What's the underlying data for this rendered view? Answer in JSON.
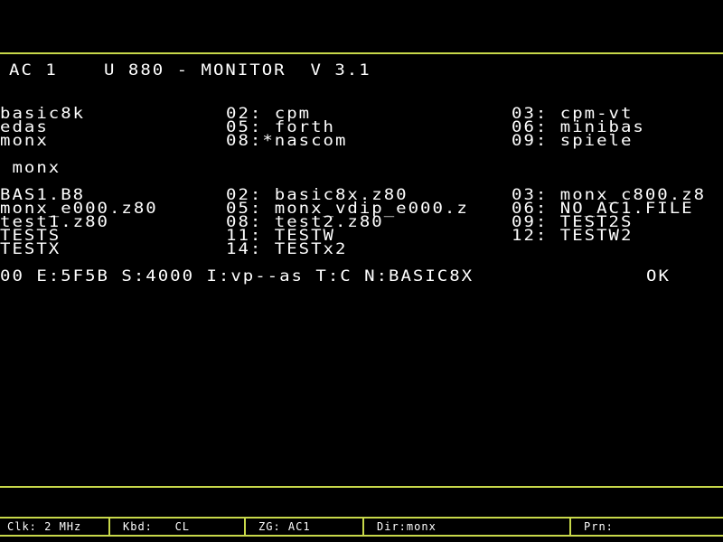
{
  "accent_color": "#c8d84a",
  "header": {
    "left": "AC 1",
    "center": "U 880 - MONITOR  V 3.1"
  },
  "lines": {
    "l1": {
      "c1": "basic8k",
      "c2": "02: cpm",
      "c3": "03: cpm-vt"
    },
    "l2": {
      "c1": "edas",
      "c2": "05: forth",
      "c3": "06: minibas"
    },
    "l3": {
      "c1": "monx",
      "c2": "08:*nascom",
      "c3": "09: spiele"
    },
    "l4": {
      "c1": " monx"
    },
    "l5": {
      "c1": "BAS1.B8",
      "c2": "02: basic8x.z80",
      "c3": "03: monx_c800.z8"
    },
    "l6": {
      "c1": "monx_e000.z80",
      "c2": "05: monx_vdip_e000.z",
      "c3": "06: NO_AC1.FILE"
    },
    "l7": {
      "c1": "test1.z80",
      "c2": "08: test2.z80",
      "c3": "09: TEST2S"
    },
    "l8": {
      "c1": "TESTS",
      "c2": "11: TESTW",
      "c3": "12: TESTW2"
    },
    "l9": {
      "c1": "TESTX",
      "c2": "14: TESTx2"
    },
    "l10": {
      "c1": "00 E:5F5B S:4000 I:vp--as T:C N:BASIC8X",
      "c2": "OK"
    }
  },
  "status_bar": {
    "clk": "Clk: 2 MHz",
    "kbd": "Kbd:   CL",
    "zg": "ZG: AC1",
    "dir": "Dir:monx",
    "prn": "Prn:"
  }
}
